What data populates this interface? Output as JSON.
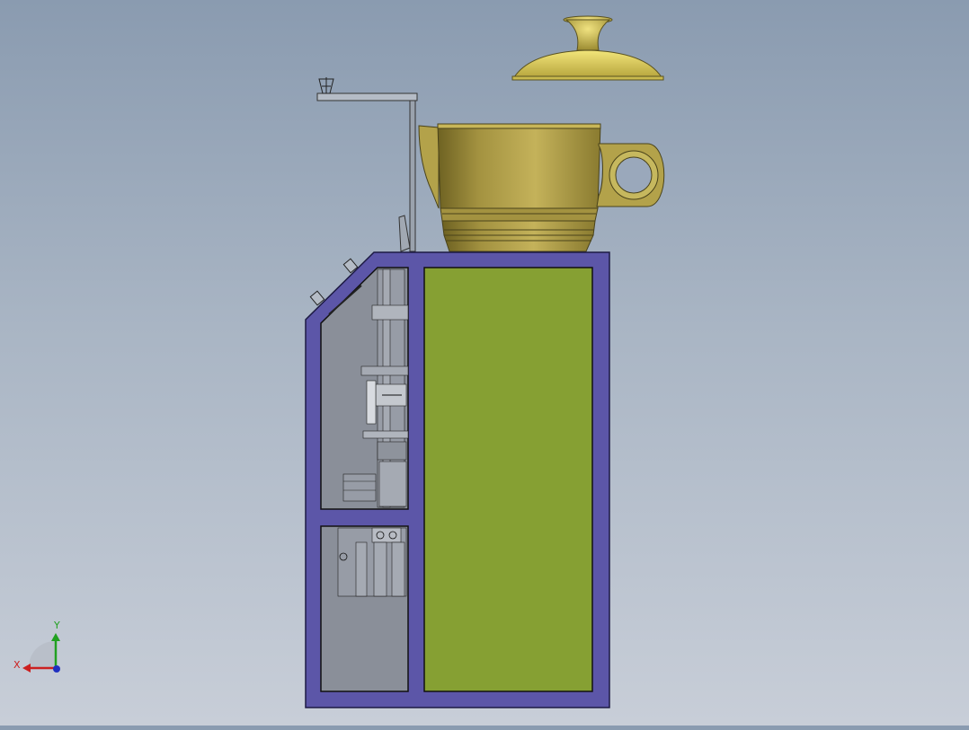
{
  "viewport": {
    "background_top": "#8a9bb0",
    "background_bottom": "#c8ced8"
  },
  "model": {
    "frame_color": "#5c56a8",
    "panel_color": "#86a033",
    "interior_color": "#8a8f99",
    "teapot_color": "#b3a24a",
    "lid_color": "#d4c75a"
  },
  "triad": {
    "x_label": "X",
    "y_label": "Y",
    "x_color": "#cc2020",
    "y_color": "#20a020",
    "z_color": "#2030c0"
  }
}
